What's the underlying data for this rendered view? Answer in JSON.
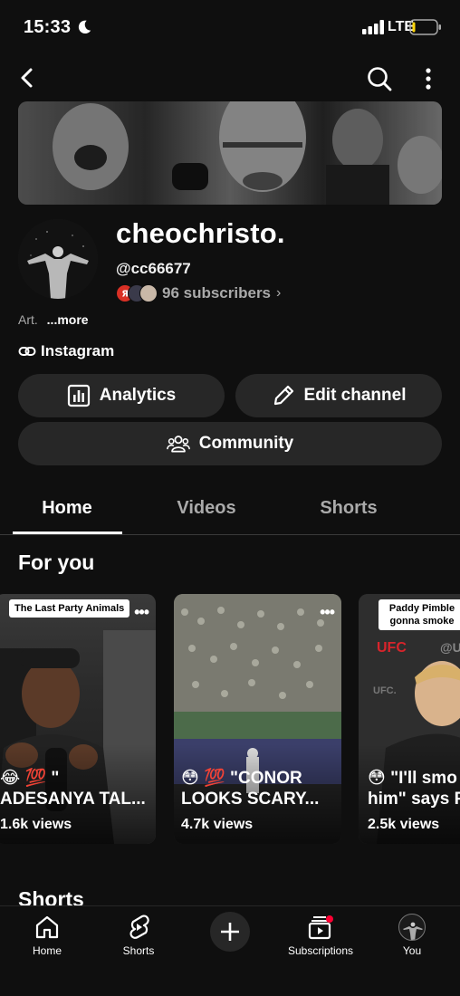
{
  "status_bar": {
    "time": "15:33",
    "network": "LTE"
  },
  "channel": {
    "name": "cheochristo.",
    "handle": "@cc66677",
    "subscribers": "96 subscribers",
    "description": "Art.",
    "more_label": "...more",
    "link_label": "Instagram"
  },
  "actions": {
    "analytics": "Analytics",
    "edit_channel": "Edit channel",
    "community": "Community"
  },
  "tabs": [
    {
      "label": "Home",
      "active": true
    },
    {
      "label": "Videos",
      "active": false
    },
    {
      "label": "Shorts",
      "active": false
    }
  ],
  "sections": {
    "for_you": "For you",
    "shorts": "Shorts"
  },
  "shorts_cards": [
    {
      "tag": "The Last Party Animals",
      "title": "😂 💯 \"\nADESANYA TAL...",
      "views": "1.6k views"
    },
    {
      "tag": "",
      "title": "😳 💯 \"CONOR\nLOOKS SCARY...",
      "views": "4.7k views"
    },
    {
      "tag": "Paddy Pimble\ngonna smoke",
      "title": "😳 \"I'll smo\nhim\" says P",
      "views": "2.5k views"
    }
  ],
  "bottom_nav": {
    "home": "Home",
    "shorts": "Shorts",
    "subscriptions": "Subscriptions",
    "you": "You"
  },
  "colors": {
    "background": "#0f0f0f",
    "button_bg": "#272727",
    "secondary_text": "#aaaaaa",
    "notification_dot": "#ff0033"
  },
  "icons": {
    "back": "back-arrow-icon",
    "search": "search-icon",
    "more": "more-vertical-icon",
    "analytics": "analytics-icon",
    "edit": "pencil-icon",
    "community": "people-icon",
    "link": "link-icon"
  }
}
